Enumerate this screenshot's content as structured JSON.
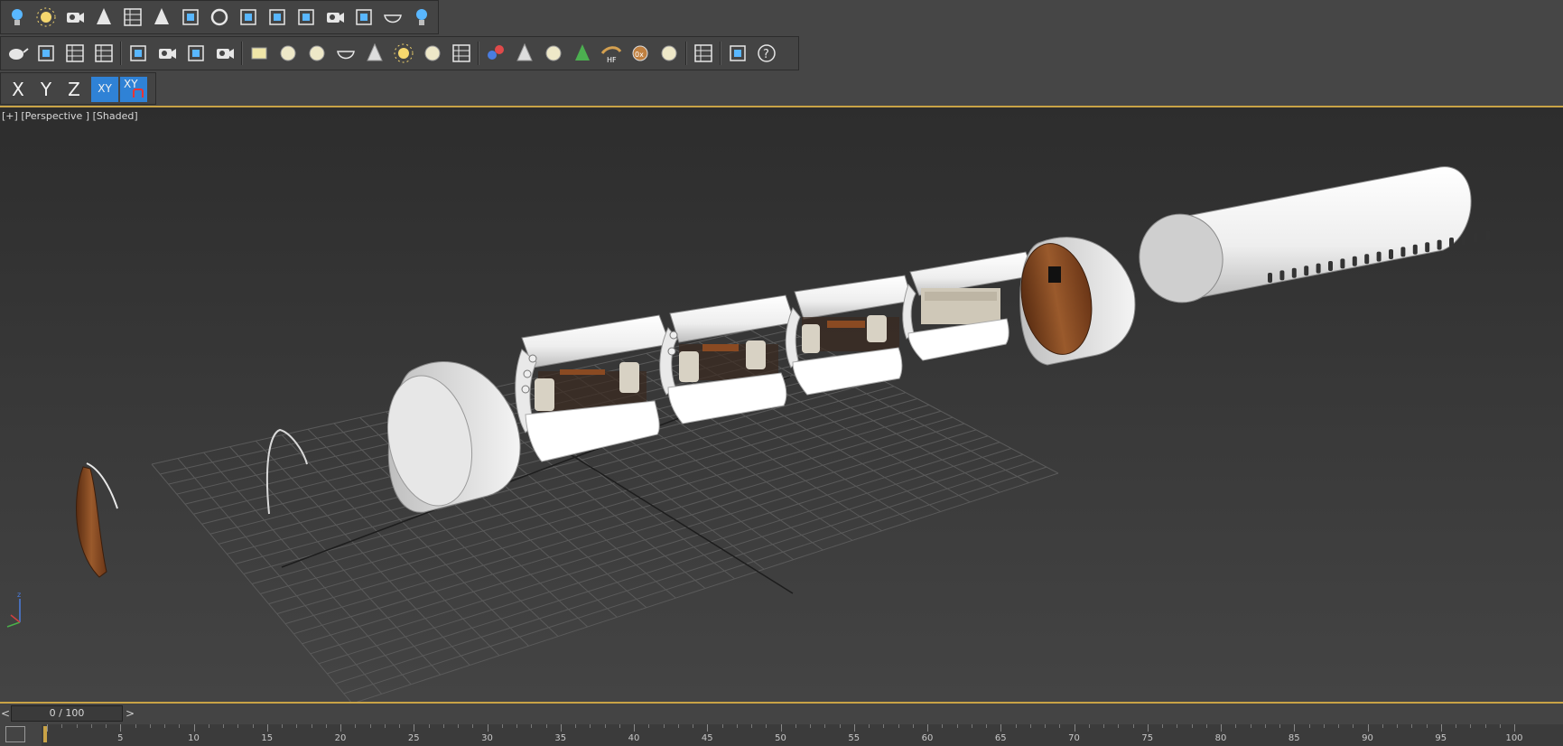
{
  "toolbar_top": {
    "icons": [
      "light-bulb-icon",
      "sun-light-icon",
      "camera-group-icon",
      "trees-icon",
      "list-panel-icon",
      "pine-tree-icon",
      "mobile-icon",
      "rotate-icon",
      "layers-icon",
      "move-box-icon",
      "render-frame-icon",
      "camera-rig-icon",
      "viewport-frame-icon",
      "dish-icon",
      "bulb-outline-icon"
    ]
  },
  "toolbar_second": {
    "icons": [
      "teapot-icon",
      "material-editor-icon",
      "list-icon",
      "table-grid-icon",
      "light-manager-icon",
      "camera-icon",
      "mirror-icon",
      "render-camera-icon",
      "plane-icon",
      "hemisphere-icon",
      "sphere-light-icon",
      "basket-icon",
      "cone-icon",
      "sun-icon",
      "ring-light-icon",
      "dots-grid-icon",
      "molecule-icon",
      "pyramid-wire-icon",
      "gear-sphere-icon",
      "grass-icon",
      "hair-fur-icon",
      "scatter-icon",
      "shade-sphere-icon",
      "material-grid-icon",
      "file-export-icon",
      "help-icon"
    ],
    "labels": {
      "hair_fur": "HF",
      "scatter": "0x"
    }
  },
  "axis_constraints": {
    "x": "X",
    "y": "Y",
    "z": "Z",
    "xy": "XY",
    "xy_lock": "XY"
  },
  "viewport": {
    "label_plus": "[+]",
    "label_view": "[Perspective ]",
    "label_shading": "[Shaded]"
  },
  "timeline": {
    "frame_display": "0 / 100",
    "prev_label": "<",
    "next_label": ">",
    "ticks": [
      "5",
      "10",
      "15",
      "20",
      "25",
      "30",
      "35",
      "40",
      "45",
      "50",
      "55",
      "60",
      "65",
      "70",
      "75",
      "80",
      "85",
      "90",
      "95",
      "100"
    ]
  },
  "colors": {
    "accent_blue": "#2f82d6",
    "viewport_border": "#c9a346",
    "fuselage_white": "#f2f2f2",
    "wood": "#8a4a22"
  }
}
